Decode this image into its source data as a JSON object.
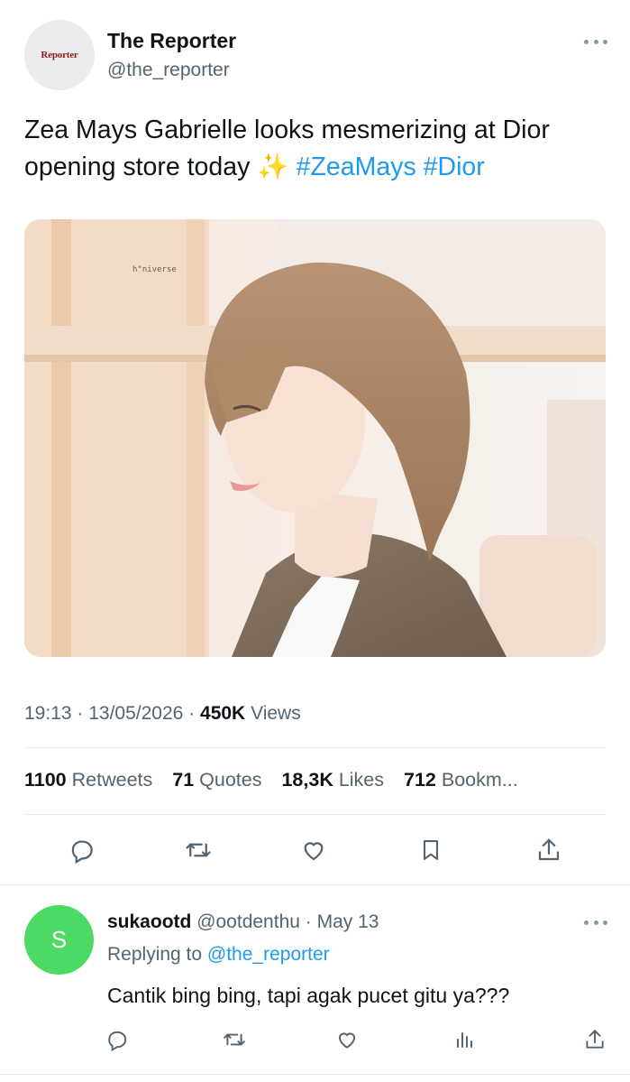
{
  "tweet": {
    "author_name": "The Reporter",
    "author_handle": "@the_reporter",
    "avatar_logo_text": "Reporter",
    "text_main": "Zea Mays Gabrielle looks mesmerizing at Dior opening store today ✨ ",
    "hashtags": [
      "#ZeaMays",
      "#Dior"
    ],
    "image_watermark": "h\"niverse",
    "time": "19:13",
    "date": "13/05/2026",
    "views_count": "450K",
    "views_label": "Views",
    "stats": [
      {
        "count": "1100",
        "label": "Retweets"
      },
      {
        "count": "71",
        "label": "Quotes"
      },
      {
        "count": "18,3K",
        "label": "Likes"
      },
      {
        "count": "712",
        "label": "Bookm..."
      }
    ],
    "actions": [
      "reply-icon",
      "retweet-icon",
      "like-icon",
      "bookmark-icon",
      "share-icon"
    ],
    "more_icon": "more-horizontal-icon"
  },
  "reply": {
    "avatar_letter": "S",
    "name": "sukaootd",
    "handle": "@ootdenthu",
    "date": "May 13",
    "replying_to_label": "Replying to",
    "replying_to_handle": "@the_reporter",
    "text": "Cantik bing bing, tapi agak pucet gitu ya???",
    "actions": [
      "reply-icon",
      "retweet-icon",
      "like-icon",
      "views-icon",
      "share-icon"
    ],
    "avatar_color": "#4cd964"
  },
  "colors": {
    "link": "#1d9bf0",
    "secondary_text": "#536471",
    "primary_text": "#0f1419"
  }
}
